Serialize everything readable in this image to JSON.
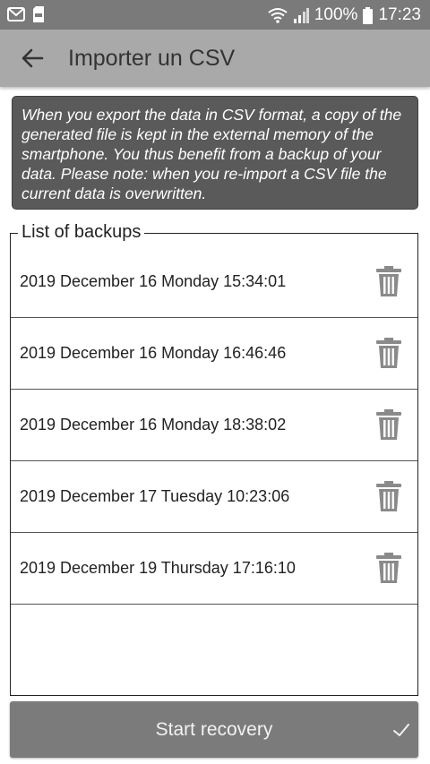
{
  "status_bar": {
    "battery": "100%",
    "time": "17:23",
    "icons": [
      "gmail-icon",
      "sim-storage-icon",
      "wifi-icon",
      "signal-icon",
      "battery-icon"
    ]
  },
  "app_bar": {
    "title": "Importer un CSV",
    "back_icon": "arrow-left-icon"
  },
  "info": {
    "text": "When you export the data in CSV format, a copy of the generated file is kept in the external memory of the smartphone. You thus benefit from a backup of your data. Please note: when you re-import a CSV file the current data is overwritten."
  },
  "backups": {
    "legend": "List of backups",
    "items": [
      {
        "label": "2019 December 16 Monday 15:34:01"
      },
      {
        "label": "2019 December 16 Monday 16:46:46"
      },
      {
        "label": "2019 December 16 Monday 18:38:02"
      },
      {
        "label": "2019 December 17 Tuesday 10:23:06"
      },
      {
        "label": "2019 December 19 Thursday 17:16:10"
      }
    ],
    "delete_icon": "trash-icon"
  },
  "action": {
    "label": "Start recovery",
    "icon": "check-icon"
  },
  "colors": {
    "status_bar": "#7a7a7a",
    "app_bar": "#a9a9a9",
    "info_bg": "#5a5a5a",
    "button_bg": "#7b7b7b"
  }
}
